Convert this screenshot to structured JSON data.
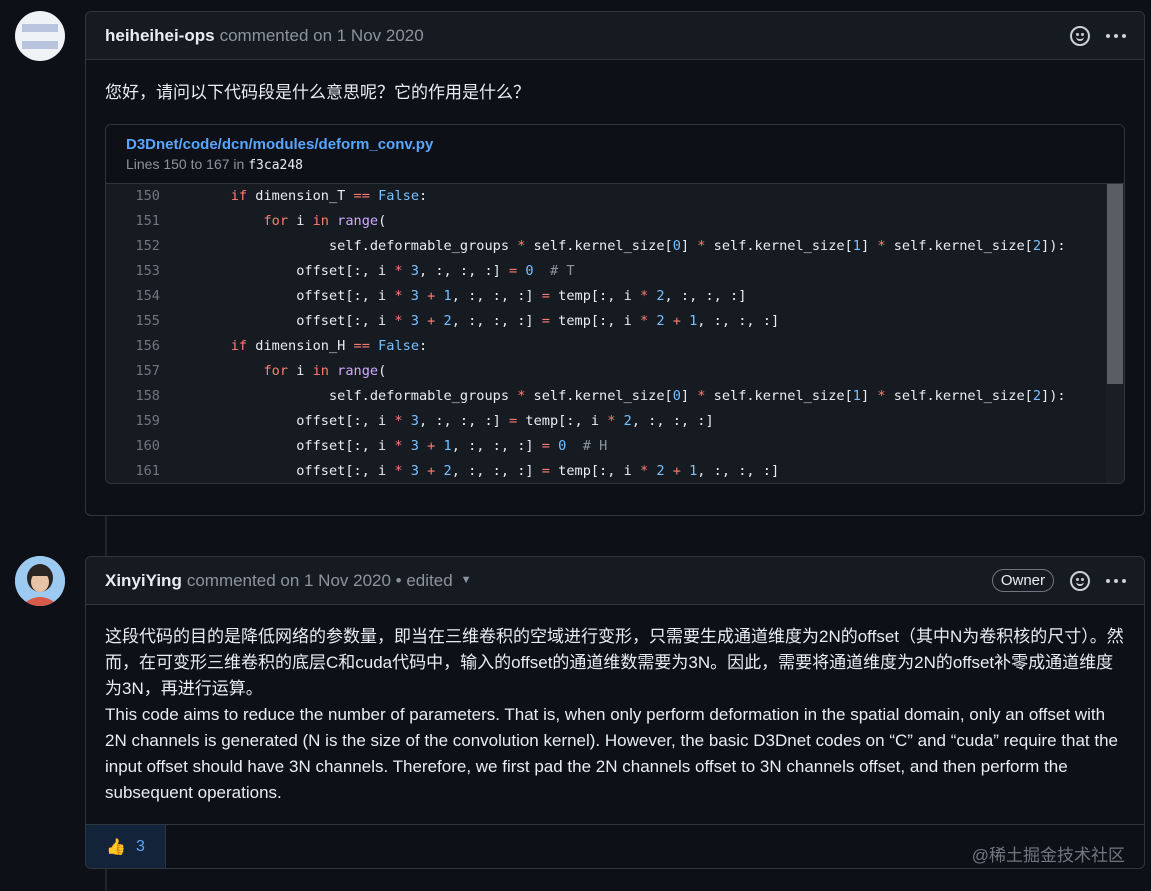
{
  "comments": [
    {
      "author": "heiheihei-ops",
      "meta": "commented on 1 Nov 2020",
      "body": "您好，请问以下代码段是什么意思呢？它的作用是什么？",
      "snippet": {
        "file": "D3Dnet/code/dcn/modules/deform_conv.py",
        "lines_prefix": "Lines 150 to 167 in ",
        "sha": "f3ca248",
        "line_numbers": [
          "150",
          "151",
          "152",
          "153",
          "154",
          "155",
          "156",
          "157",
          "158",
          "159",
          "160",
          "161"
        ]
      }
    },
    {
      "author": "XinyiYing",
      "meta": "commented on 1 Nov 2020 • edited",
      "badge": "Owner",
      "body_cn": "这段代码的目的是降低网络的参数量，即当在三维卷积的空域进行变形，只需要生成通道维度为2N的offset（其中N为卷积核的尺寸）。然而，在可变形三维卷积的底层C和cuda代码中，输入的offset的通道维数需要为3N。因此，需要将通道维度为2N的offset补零成通道维度为3N，再进行运算。",
      "body_en": "This code aims to reduce the number of parameters. That is, when only perform deformation in the spatial domain, only an offset with 2N channels is generated (N is the size of the convolution kernel). However, the basic D3Dnet codes on “C” and “cuda” require that the input offset should have 3N channels. Therefore, we first pad the 2N channels offset to 3N channels offset, and then perform the subsequent operations.",
      "reaction_count": "3"
    }
  ],
  "watermark": "@稀土掘金技术社区",
  "icons": {
    "reaction": "smile-icon",
    "menu": "kebab-icon",
    "thumbs": "thumbs-up-icon"
  }
}
